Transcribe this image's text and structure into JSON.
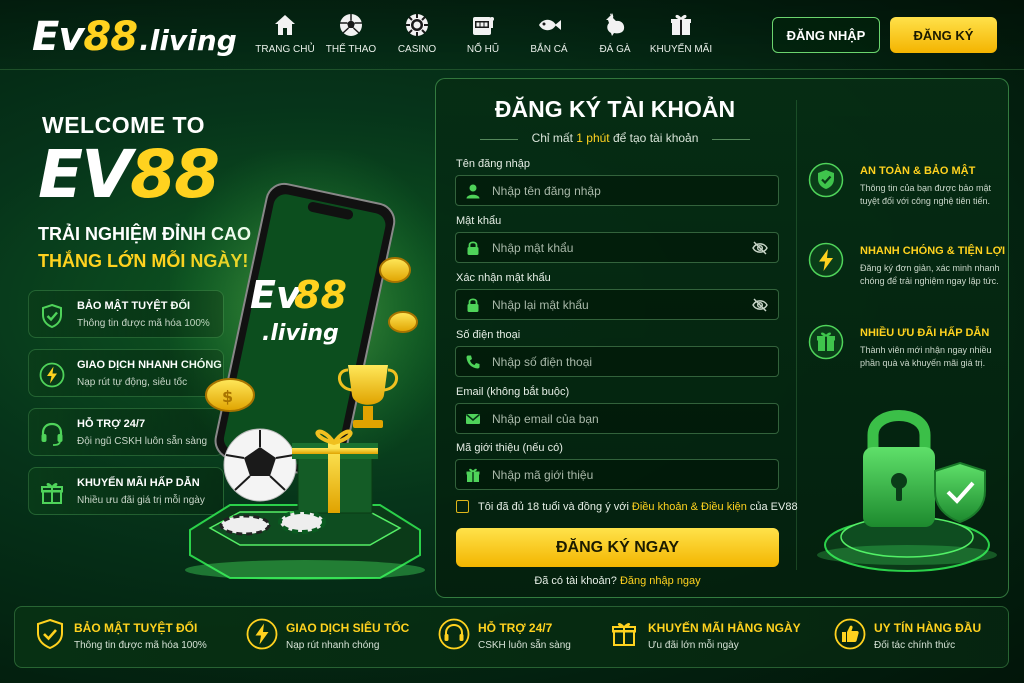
{
  "header": {
    "logo": {
      "ev": "Ev",
      "num": "88",
      "domain": ".living"
    },
    "nav": [
      {
        "label": "TRANG CHỦ",
        "icon": "home-icon"
      },
      {
        "label": "THỂ THAO",
        "icon": "soccer-ball-icon"
      },
      {
        "label": "CASINO",
        "icon": "casino-chip-icon"
      },
      {
        "label": "NỔ HŨ",
        "icon": "slot-machine-icon"
      },
      {
        "label": "BẮN CÁ",
        "icon": "fish-icon"
      },
      {
        "label": "ĐÁ GÀ",
        "icon": "rooster-icon"
      },
      {
        "label": "KHUYẾN MÃI",
        "icon": "gift-icon"
      }
    ],
    "login_label": "ĐĂNG NHẬP",
    "register_label": "ĐĂNG KÝ"
  },
  "hero": {
    "welcome": "WELCOME TO",
    "brand_white": "EV",
    "brand_yellow": "88",
    "tagline1": "TRẢI NGHIỆM ĐỈNH CAO",
    "tagline2": "THẮNG LỚN MỖI NGÀY!",
    "phone_logo": {
      "ev": "Ev",
      "num": "88",
      "domain": ".living"
    },
    "features": [
      {
        "title": "BẢO MẬT TUYỆT ĐỐI",
        "desc": "Thông tin được mã hóa 100%",
        "icon": "shield-check-icon"
      },
      {
        "title": "GIAO DỊCH NHANH CHÓNG",
        "desc": "Nạp rút tự động, siêu tốc",
        "icon": "lightning-icon"
      },
      {
        "title": "HỖ TRỢ 24/7",
        "desc": "Đội ngũ CSKH luôn sẵn sàng",
        "icon": "headset-icon"
      },
      {
        "title": "KHUYẾN MÃI HẤP DẪN",
        "desc": "Nhiều ưu đãi giá trị mỗi ngày",
        "icon": "gift-icon"
      }
    ]
  },
  "form": {
    "title": "ĐĂNG KÝ TÀI KHOẢN",
    "subtitle_pre": "Chỉ mất ",
    "subtitle_hl": "1 phút",
    "subtitle_post": " để tạo tài khoản",
    "fields": [
      {
        "label": "Tên đăng nhập",
        "placeholder": "Nhập tên đăng nhập",
        "value": "",
        "icon": "user-icon"
      },
      {
        "label": "Mật khẩu",
        "placeholder": "Nhập mật khẩu",
        "value": "",
        "icon": "lock-icon"
      },
      {
        "label": "Xác nhận mật khẩu",
        "placeholder": "Nhập lại mật khẩu",
        "value": "",
        "icon": "lock-icon"
      },
      {
        "label": "Số điện thoại",
        "placeholder": "Nhập số điện thoại",
        "value": "",
        "icon": "phone-icon"
      },
      {
        "label": "Email (không bắt buộc)",
        "placeholder": "Nhập email của bạn",
        "value": "",
        "icon": "mail-icon"
      },
      {
        "label": "Mã giới thiệu (nếu có)",
        "placeholder": "Nhập mã giới thiệu",
        "value": "",
        "icon": "gift-icon"
      }
    ],
    "agree_pre": "Tôi đã đủ 18 tuổi và đồng ý với",
    "agree_link": "Điều khoản & Điều kiện",
    "agree_post": "của EV88",
    "submit_label": "ĐĂNG KÝ NGAY",
    "have_account": "Đã có tài khoản?",
    "login_now": "Đăng nhập ngay"
  },
  "side": [
    {
      "title": "AN TOÀN & BẢO MẬT",
      "desc": "Thông tin của bạn được bảo mật tuyệt đối với công nghệ tiên tiến.",
      "icon": "shield-check-icon"
    },
    {
      "title": "NHANH CHÓNG & TIỆN LỢI",
      "desc": "Đăng ký đơn giản, xác minh nhanh chóng để trải nghiệm ngay lập tức.",
      "icon": "lightning-icon"
    },
    {
      "title": "NHIỀU ƯU ĐÃI HẤP DẪN",
      "desc": "Thành viên mới nhận ngay nhiều phần quà và khuyến mãi giá trị.",
      "icon": "gift-icon"
    }
  ],
  "bottom": [
    {
      "title": "BẢO MẬT TUYỆT ĐỐI",
      "desc": "Thông tin được mã hóa 100%",
      "icon": "shield-check-icon"
    },
    {
      "title": "GIAO DỊCH SIÊU TỐC",
      "desc": "Nạp rút nhanh chóng",
      "icon": "lightning-icon"
    },
    {
      "title": "HỖ TRỢ 24/7",
      "desc": "CSKH luôn sẵn sàng",
      "icon": "headset-icon"
    },
    {
      "title": "KHUYẾN MÃI HẰNG NGÀY",
      "desc": "Ưu đãi lớn mỗi ngày",
      "icon": "gift-icon"
    },
    {
      "title": "UY TÍN HÀNG ĐẦU",
      "desc": "Đối tác chính thức",
      "icon": "thumbs-up-icon"
    }
  ],
  "colors": {
    "accent": "#ffd21f",
    "green": "#4fd35a",
    "bg": "#03200f"
  }
}
